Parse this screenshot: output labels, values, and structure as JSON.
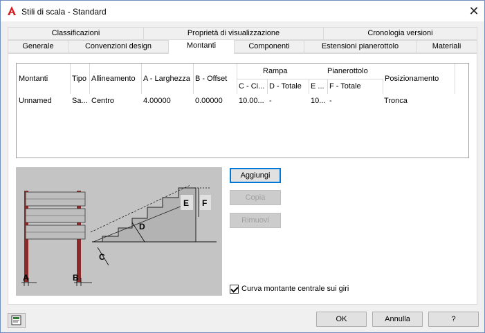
{
  "window": {
    "title": "Stili di scala - Standard"
  },
  "icons": {
    "app": "autocad-a-icon",
    "close": "close-icon",
    "help": "help-doc-icon"
  },
  "tabs_row1": [
    "Classificazioni",
    "Proprietà di visualizzazione",
    "Cronologia versioni"
  ],
  "tabs_row2": [
    "Generale",
    "Convenzioni design",
    "Montanti",
    "Componenti",
    "Estensioni pianerottolo",
    "Materiali"
  ],
  "active_tab": "Montanti",
  "grid": {
    "headers": {
      "montanti": "Montanti",
      "tipo": "Tipo",
      "allineamento": "Allineamento",
      "larghezza": "A - Larghezza",
      "offset": "B - Offset",
      "rampa": "Rampa",
      "rampa_c": "C - Ci...",
      "rampa_d": "D - Totale",
      "pian_e": "E ...",
      "pianerottolo": "Pianerottolo",
      "pian_f": "F - Totale",
      "posizionamento": "Posizionamento"
    },
    "rows": [
      {
        "montanti": "Unnamed",
        "tipo": "Sa...",
        "allineamento": "Centro",
        "larghezza": "4.00000",
        "offset": "0.00000",
        "rampa_c": "10.00...",
        "rampa_d": "-",
        "pian_e": "10...",
        "pian_f": "-",
        "posizionamento": "Tronca"
      }
    ]
  },
  "illustration": {
    "labels": {
      "a": "A",
      "b": "B",
      "c": "C",
      "d": "D",
      "e": "E",
      "f": "F"
    }
  },
  "buttons": {
    "add": "Aggiungi",
    "copy": "Copia",
    "remove": "Rimuovi",
    "ok": "OK",
    "cancel": "Annulla",
    "help": "?"
  },
  "checkbox": {
    "label": "Curva montante centrale sui giri",
    "checked": true
  },
  "colors": {
    "accent": "#0078d7",
    "tab_active": "#ffffff",
    "panel": "#f0f0f0"
  }
}
